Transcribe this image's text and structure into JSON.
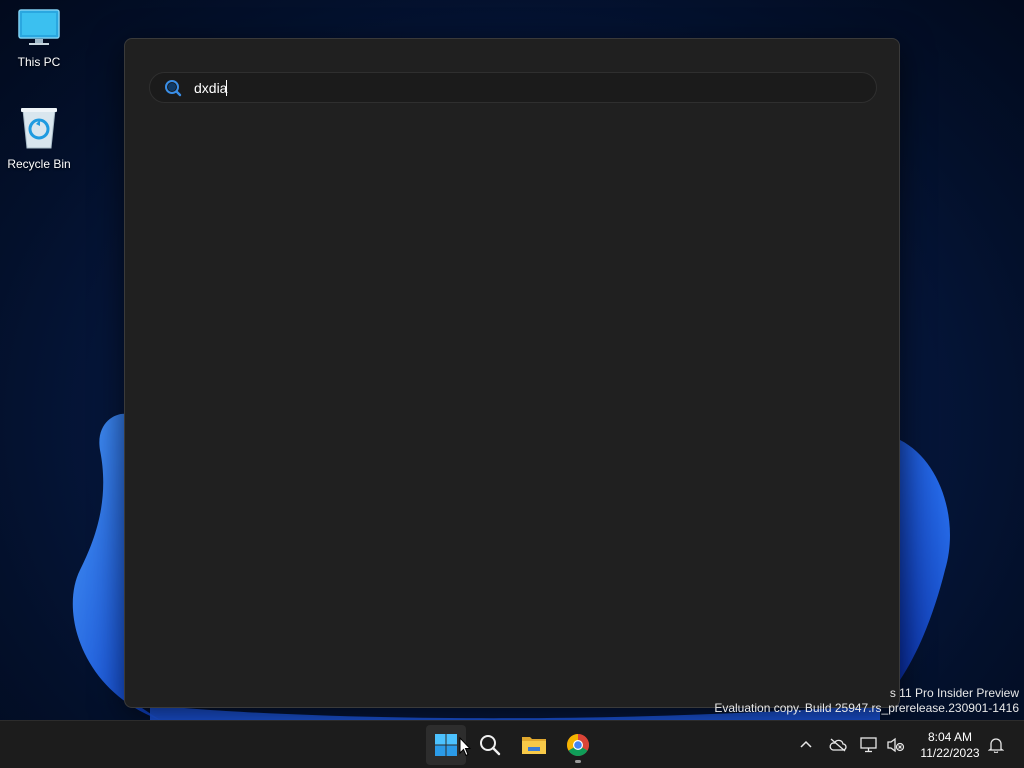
{
  "desktop": {
    "icons": [
      {
        "label": "This PC",
        "icon": "monitor-icon"
      },
      {
        "label": "Recycle Bin",
        "icon": "recycle-bin-icon"
      }
    ]
  },
  "search": {
    "query": "dxdia",
    "icon": "search-icon"
  },
  "watermark": {
    "line1": "s 11 Pro Insider Preview",
    "line2": "Evaluation copy. Build 25947.rs_prerelease.230901-1416"
  },
  "taskbar": {
    "apps": [
      {
        "name": "Start",
        "icon": "windows-start-icon"
      },
      {
        "name": "Search",
        "icon": "search-icon"
      },
      {
        "name": "File Explorer",
        "icon": "folder-icon"
      },
      {
        "name": "Google Chrome",
        "icon": "chrome-icon"
      }
    ],
    "tray": {
      "time": "8:04 AM",
      "date": "11/22/2023"
    }
  },
  "colors": {
    "accent": "#3a8ee6",
    "panel_bg": "#202020",
    "taskbar_bg": "#1c1c1c"
  }
}
